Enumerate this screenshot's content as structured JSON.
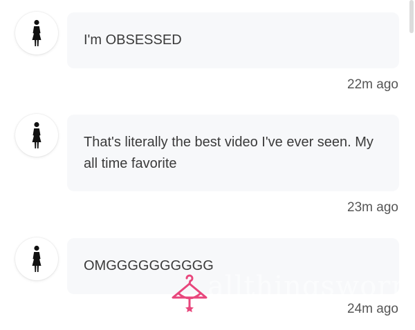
{
  "messages": [
    {
      "text": "I'm OBSESSED",
      "time": "22m ago",
      "avatar_icon": "woman-figure-icon"
    },
    {
      "text": "That's literally the best video I've ever seen. My all time favorite",
      "time": "23m ago",
      "avatar_icon": "woman-figure-icon"
    },
    {
      "text": "OMGGGGGGGGGG",
      "time": "24m ago",
      "avatar_icon": "woman-figure-icon"
    }
  ],
  "watermark": {
    "text": "allthingsworn",
    "logo_icon": "hanger-bow-icon",
    "color": "#e8467c"
  }
}
